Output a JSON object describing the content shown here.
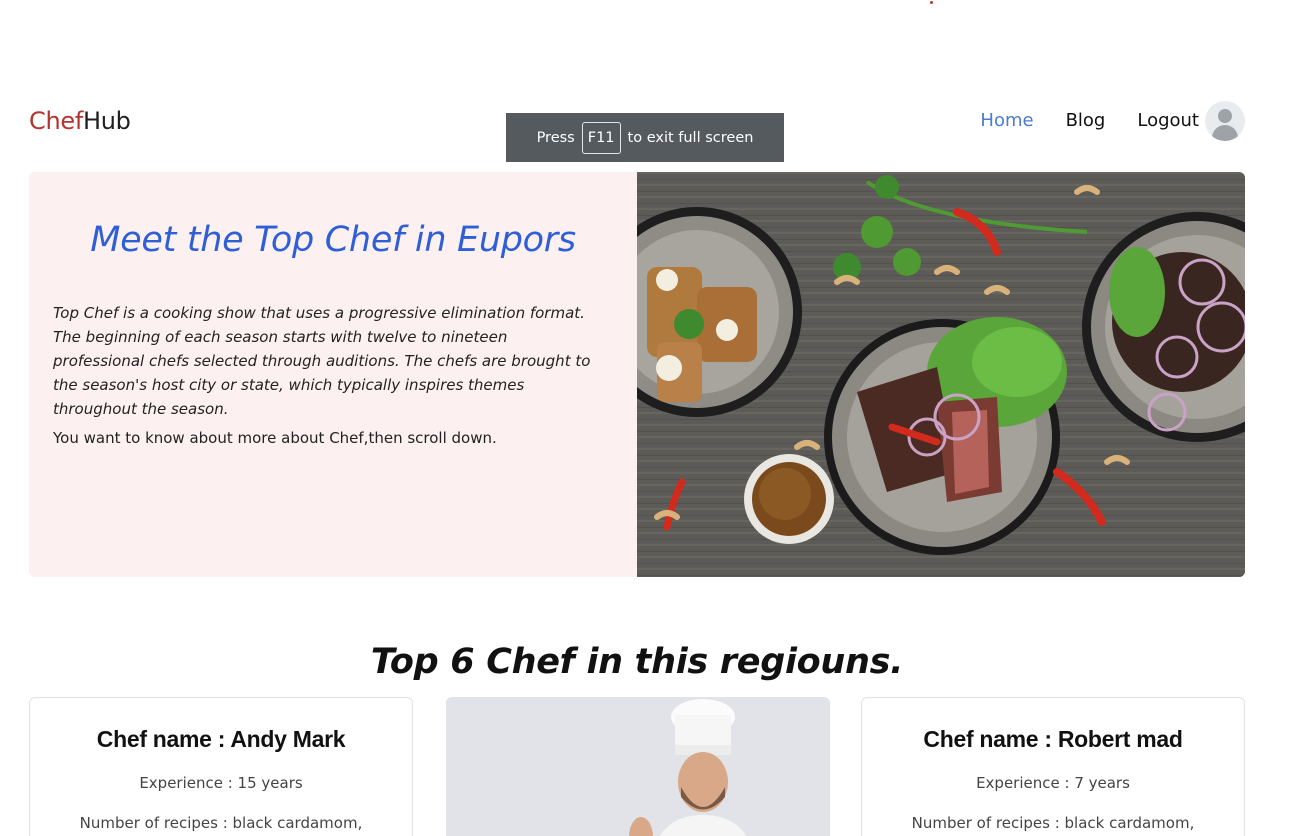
{
  "brand": {
    "part1": "Chef",
    "part2": "Hub"
  },
  "nav": {
    "home": "Home",
    "blog": "Blog",
    "logout": "Logout"
  },
  "toast": {
    "press": "Press",
    "key": "F11",
    "rest": "to exit full screen"
  },
  "hero": {
    "title": "Meet the Top Chef in Eupors",
    "text": "Top Chef is a cooking show that uses a progressive elimination format. The beginning of each season starts with twelve to nineteen professional chefs selected through auditions. The chefs are brought to the season's host city or state, which typically inspires themes throughout the season.",
    "sub": "You want to know about more about Chef,then scroll down."
  },
  "section_title": "Top 6 Chef in this regiouns.",
  "cards": [
    {
      "name": "Chef name : Andy Mark",
      "experience": "Experience : 15 years",
      "recipes": "Number of recipes : black cardamom,"
    },
    {
      "name": "Chef name : Robert mad",
      "experience": "Experience : 7 years",
      "recipes": "Number of recipes : black cardamom,"
    }
  ],
  "colors": {
    "brand_red": "#b3342f",
    "link_active": "#4a7bd4",
    "hero_bg": "#fdf0f1",
    "hero_title": "#2f5fd6"
  },
  "icons": {
    "avatar": "user-avatar-icon"
  }
}
